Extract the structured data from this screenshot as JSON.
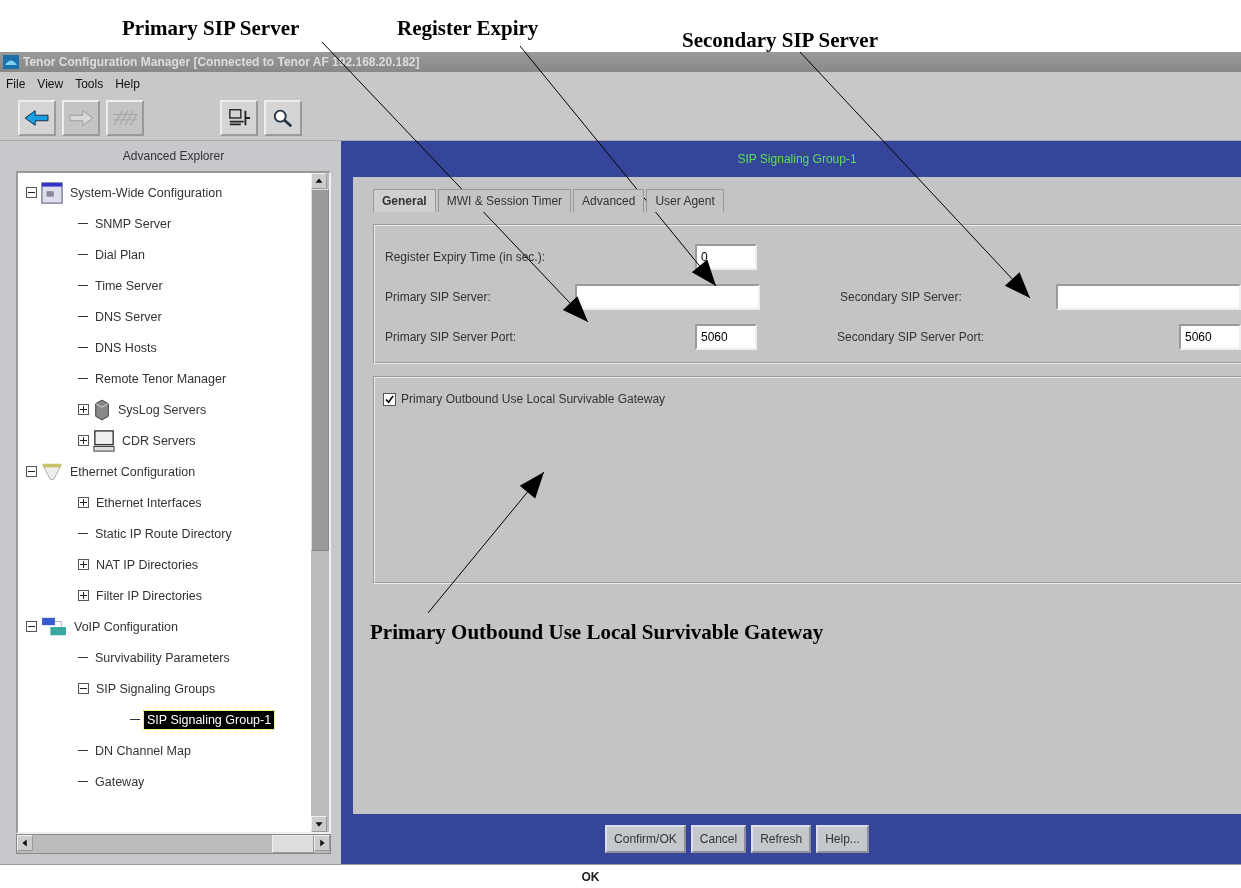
{
  "annotations": [
    {
      "label": "Primary SIP Server"
    },
    {
      "label": "Register Expiry"
    },
    {
      "label": "Secondary SIP Server"
    },
    {
      "label": "Primary Outbound Use Local Survivable Gateway"
    }
  ],
  "window": {
    "title": "Tenor Configuration Manager [Connected to Tenor AF 192.168.20.182]"
  },
  "menu": [
    "File",
    "View",
    "Tools",
    "Help"
  ],
  "toolbar": [
    {
      "disabled": false
    },
    {
      "disabled": true
    },
    {
      "disabled": true
    },
    {
      "disabled": false
    },
    {
      "disabled": false
    }
  ],
  "explorer": {
    "title": "Advanced Explorer",
    "tree": [
      {
        "label": "System-Wide Configuration",
        "kind": "folder",
        "expanded": true,
        "selected": false,
        "children": [
          {
            "label": "SNMP Server",
            "kind": "leaf",
            "selected": false
          },
          {
            "label": "Dial Plan",
            "kind": "leaf",
            "selected": false
          },
          {
            "label": "Time Server",
            "kind": "leaf",
            "selected": false
          },
          {
            "label": "DNS Server",
            "kind": "leaf",
            "selected": false
          },
          {
            "label": "DNS Hosts",
            "kind": "leaf",
            "selected": false
          },
          {
            "label": "Remote Tenor Manager",
            "kind": "leaf",
            "selected": false
          },
          {
            "label": "SysLog Servers",
            "kind": "folder",
            "expanded": false,
            "selected": false
          },
          {
            "label": "CDR Servers",
            "kind": "folder",
            "expanded": false,
            "selected": false
          }
        ]
      },
      {
        "label": "Ethernet Configuration",
        "kind": "folder",
        "expanded": true,
        "selected": false,
        "children": [
          {
            "label": "Ethernet Interfaces",
            "kind": "folder",
            "expanded": false,
            "selected": false
          },
          {
            "label": "Static IP Route Directory",
            "kind": "leaf",
            "selected": false
          },
          {
            "label": "NAT IP Directories",
            "kind": "folder",
            "expanded": false,
            "selected": false
          },
          {
            "label": "Filter IP Directories",
            "kind": "folder",
            "expanded": false,
            "selected": false
          }
        ]
      },
      {
        "label": "VoIP Configuration",
        "kind": "folder",
        "expanded": true,
        "selected": false,
        "children": [
          {
            "label": "Survivability Parameters",
            "kind": "leaf",
            "selected": false
          },
          {
            "label": "SIP Signaling Groups",
            "kind": "folder",
            "expanded": true,
            "selected": false,
            "children": [
              {
                "label": "SIP Signaling Group-1",
                "kind": "leaf",
                "selected": true
              }
            ]
          },
          {
            "label": "DN Channel Map",
            "kind": "leaf",
            "selected": false
          },
          {
            "label": "Gateway",
            "kind": "leaf",
            "selected": false
          }
        ]
      }
    ]
  },
  "panel": {
    "title": "SIP Signaling Group-1",
    "tabs": [
      {
        "label": "General",
        "selected": true
      },
      {
        "label": "MWI & Session Timer",
        "selected": false
      },
      {
        "label": "Advanced",
        "selected": false
      },
      {
        "label": "User Agent",
        "selected": false
      }
    ],
    "field_rows": [
      [
        {
          "label": "Register Expiry Time (in sec.):",
          "kind": "number",
          "value": "0"
        }
      ],
      [
        {
          "label": "Primary SIP Server:",
          "kind": "text"
        },
        {
          "label": "Secondary SIP Server:",
          "kind": "text"
        }
      ],
      [
        {
          "label": "Primary SIP Server Port:",
          "kind": "number",
          "value": "5060"
        },
        {
          "label": "Secondary SIP Server Port:",
          "kind": "number",
          "value": "5060"
        }
      ]
    ],
    "checkbox": {
      "label": "Primary Outbound Use Local Survivable Gateway",
      "checked": true
    },
    "buttons": [
      "Confirm/OK",
      "Cancel",
      "Refresh",
      "Help..."
    ]
  },
  "status_bar": "OK"
}
